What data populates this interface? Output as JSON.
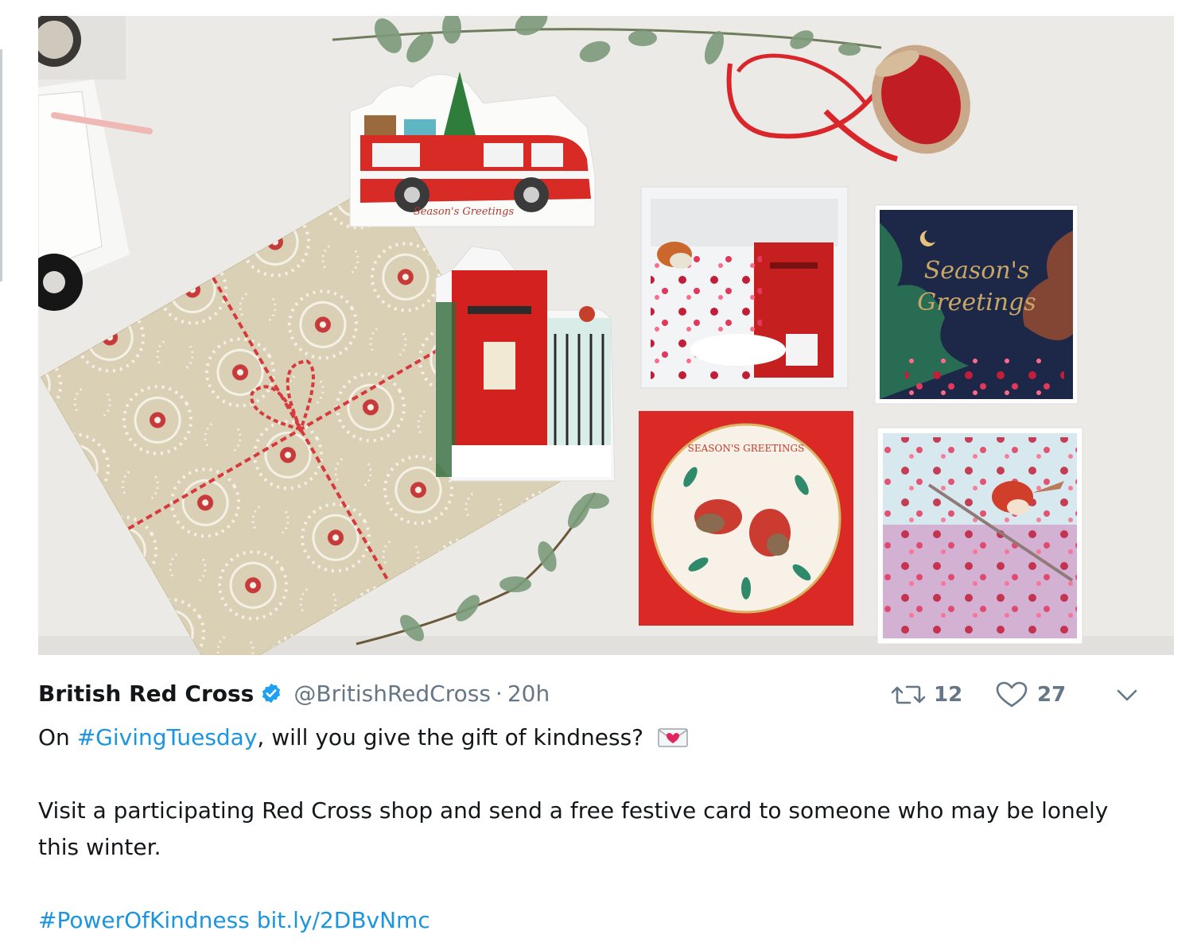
{
  "author": {
    "name": "British Red Cross",
    "handle": "@BritishRedCross",
    "separator": "·",
    "time": "20h",
    "verified_icon": "verified-badge-icon"
  },
  "photo": {
    "card_texts": {
      "van_card": "Season's Greetings",
      "navy_card_line1": "Season's",
      "navy_card_line2": "Greetings",
      "red_card": "SEASON'S GREETINGS"
    }
  },
  "actions": {
    "retweet_count": "12",
    "like_count": "27",
    "retweet_icon": "retweet-icon",
    "like_icon": "heart-icon",
    "more_icon": "chevron-down-icon"
  },
  "tweet": {
    "line1_prefix": "On ",
    "line1_hashtag": "#GivingTuesday",
    "line1_suffix": ", will you give the gift of kindness?",
    "line1_emoji": "love-letter-icon",
    "paragraph2": "Visit a participating Red Cross shop and send a free festive card to someone who may be lonely this winter.",
    "hashtag2": "#PowerOfKindness",
    "link": "bit.ly/2DBvNmc"
  },
  "colors": {
    "link": "#1b95e0",
    "text": "#14171a",
    "muted": "#657786",
    "verified": "#1da1f2"
  }
}
